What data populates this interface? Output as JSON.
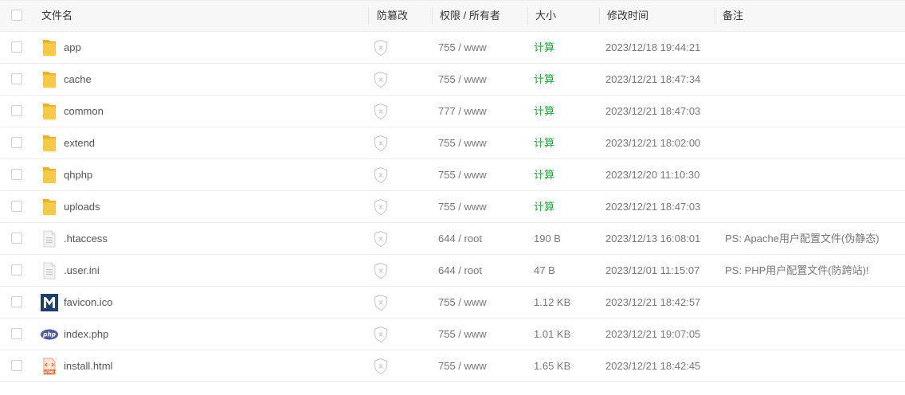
{
  "header": {
    "name": "文件名",
    "tamper": "防篡改",
    "perm": "权限 / 所有者",
    "size": "大小",
    "time": "修改时间",
    "note": "备注"
  },
  "rows": [
    {
      "name": "app",
      "icon": "folder-icon",
      "perm": "755 / www",
      "size": "计算",
      "time": "2023/12/18 19:44:21",
      "note": ""
    },
    {
      "name": "cache",
      "icon": "folder-icon",
      "perm": "755 / www",
      "size": "计算",
      "time": "2023/12/21 18:47:34",
      "note": ""
    },
    {
      "name": "common",
      "icon": "folder-icon",
      "perm": "777 / www",
      "size": "计算",
      "time": "2023/12/21 18:47:03",
      "note": ""
    },
    {
      "name": "extend",
      "icon": "folder-icon",
      "perm": "755 / www",
      "size": "计算",
      "time": "2023/12/21 18:02:00",
      "note": ""
    },
    {
      "name": "qhphp",
      "icon": "folder-icon",
      "perm": "755 / www",
      "size": "计算",
      "time": "2023/12/20 11:10:30",
      "note": ""
    },
    {
      "name": "uploads",
      "icon": "folder-icon",
      "perm": "755 / www",
      "size": "计算",
      "time": "2023/12/21 18:47:03",
      "note": ""
    },
    {
      "name": ".htaccess",
      "icon": "text-file-icon",
      "perm": "644 / root",
      "size": "190 B",
      "time": "2023/12/13 16:08:01",
      "note": "PS: Apache用户配置文件(伪静态)"
    },
    {
      "name": ".user.ini",
      "icon": "text-file-icon",
      "perm": "644 / root",
      "size": "47 B",
      "time": "2023/12/01 11:15:07",
      "note": "PS: PHP用户配置文件(防跨站)!"
    },
    {
      "name": "favicon.ico",
      "icon": "favicon-icon",
      "perm": "755 / www",
      "size": "1.12 KB",
      "time": "2023/12/21 18:42:57",
      "note": ""
    },
    {
      "name": "index.php",
      "icon": "php-file-icon",
      "perm": "755 / www",
      "size": "1.01 KB",
      "time": "2023/12/21 19:07:05",
      "note": ""
    },
    {
      "name": "install.html",
      "icon": "html-file-icon",
      "perm": "755 / www",
      "size": "1.65 KB",
      "time": "2023/12/21 18:42:45",
      "note": ""
    }
  ],
  "colors": {
    "calc": "#20a53a",
    "folder": "#f7c948"
  }
}
